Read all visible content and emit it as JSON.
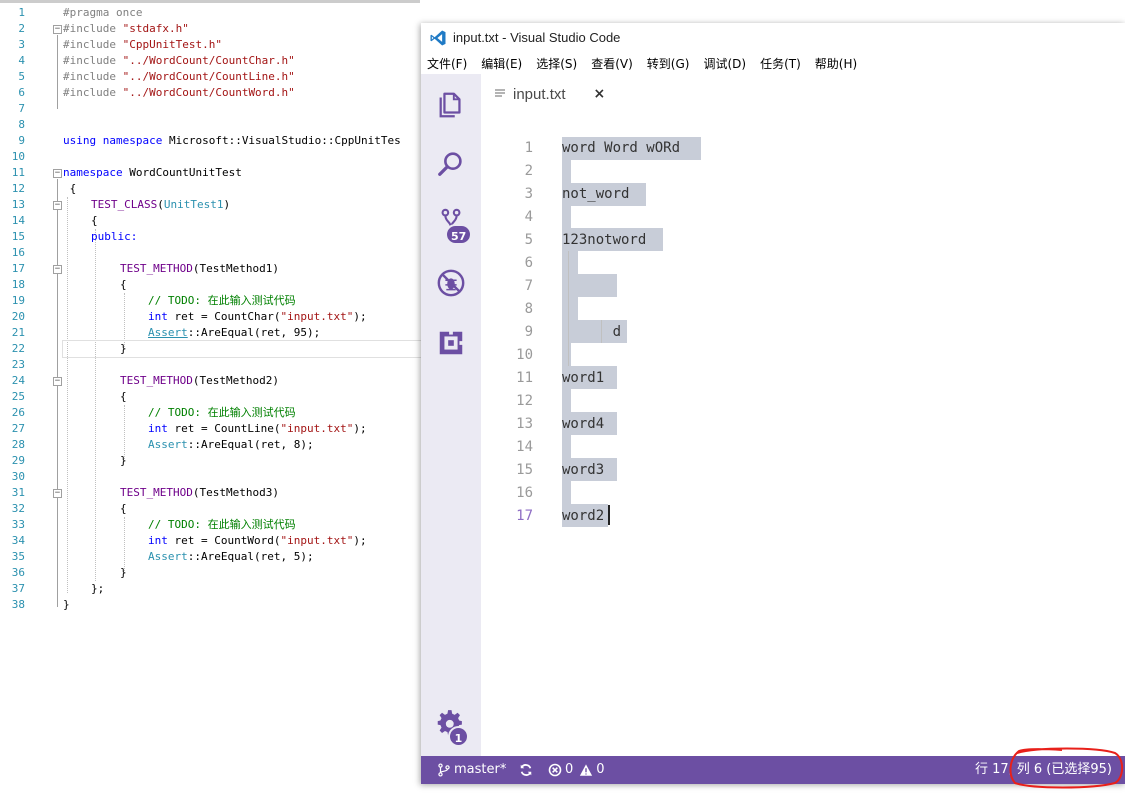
{
  "vs_editor": {
    "line_numbers": [
      "1",
      "2",
      "3",
      "4",
      "5",
      "6",
      "7",
      "8",
      "9",
      "10",
      "11",
      "12",
      "13",
      "14",
      "15",
      "16",
      "17",
      "18",
      "19",
      "20",
      "21",
      "22",
      "23",
      "24",
      "25",
      "26",
      "27",
      "28",
      "29",
      "30",
      "31",
      "32",
      "33",
      "34",
      "35",
      "36",
      "37",
      "38"
    ],
    "code": {
      "l1": "#pragma once",
      "l2a": "#include ",
      "l2b": "\"stdafx.h\"",
      "l3a": "#include ",
      "l3b": "\"CppUnitTest.h\"",
      "l4a": "#include ",
      "l4b": "\"../WordCount/CountChar.h\"",
      "l5a": "#include ",
      "l5b": "\"../WordCount/CountLine.h\"",
      "l6a": "#include ",
      "l6b": "\"../WordCount/CountWord.h\"",
      "l9a": "using namespace",
      "l9b": " Microsoft::VisualStudio::CppUnitTes",
      "l11a": "namespace",
      "l11b": " WordCountUnitTest",
      "l12": " {",
      "l13a": "TEST_CLASS",
      "l13b": "(",
      "l13c": "UnitTest1",
      "l13d": ")",
      "l14": "{",
      "l15": "public:",
      "l17a": "TEST_METHOD",
      "l17b": "(TestMethod1)",
      "l18": "{",
      "l19": "// TODO: 在此输入测试代码",
      "l20a": "int",
      "l20b": " ret = CountChar(",
      "l20c": "\"input.txt\"",
      "l20d": ");",
      "l21a": "Assert",
      "l21b": "::AreEqual(ret, 95);",
      "l22": "}",
      "l24a": "TEST_METHOD",
      "l24b": "(TestMethod2)",
      "l25": "{",
      "l26": "// TODO: 在此输入测试代码",
      "l27a": "int",
      "l27b": " ret = CountLine(",
      "l27c": "\"input.txt\"",
      "l27d": ");",
      "l28a": "Assert",
      "l28b": "::AreEqual(ret, 8);",
      "l29": "}",
      "l31a": "TEST_METHOD",
      "l31b": "(TestMethod3)",
      "l32": "{",
      "l33": "// TODO: 在此输入测试代码",
      "l34a": "int",
      "l34b": " ret = CountWord(",
      "l34c": "\"input.txt\"",
      "l34d": ");",
      "l35a": "Assert",
      "l35b": "::AreEqual(ret, 5);",
      "l36": "}",
      "l37": "};",
      "l38": "}"
    },
    "fold_symbol": "−"
  },
  "vscode": {
    "title": "input.txt - Visual Studio Code",
    "menu": [
      "文件(F)",
      "编辑(E)",
      "选择(S)",
      "查看(V)",
      "转到(G)",
      "调试(D)",
      "任务(T)",
      "帮助(H)"
    ],
    "activity": {
      "explorer_icon": "files-icon",
      "search_icon": "search-icon",
      "scm_icon": "source-control-icon",
      "scm_badge": "57",
      "debug_icon": "debug-icon",
      "extensions_icon": "extensions-icon",
      "settings_icon": "gear-icon",
      "settings_badge": "1"
    },
    "tab": {
      "label": "input.txt",
      "close": "×"
    },
    "lines": [
      {
        "n": "1",
        "text": "word Word wORd"
      },
      {
        "n": "2",
        "text": ""
      },
      {
        "n": "3",
        "text": "not_word"
      },
      {
        "n": "4",
        "text": ""
      },
      {
        "n": "5",
        "text": "123notword"
      },
      {
        "n": "6",
        "text": ""
      },
      {
        "n": "7",
        "text": ""
      },
      {
        "n": "8",
        "text": ""
      },
      {
        "n": "9",
        "text": "      d"
      },
      {
        "n": "10",
        "text": ""
      },
      {
        "n": "11",
        "text": "word1"
      },
      {
        "n": "12",
        "text": ""
      },
      {
        "n": "13",
        "text": "word4"
      },
      {
        "n": "14",
        "text": ""
      },
      {
        "n": "15",
        "text": "word3"
      },
      {
        "n": "16",
        "text": ""
      },
      {
        "n": "17",
        "text": "word2"
      }
    ],
    "active_line": "17",
    "status": {
      "branch": "master*",
      "errors": "0",
      "warnings": "0",
      "row_label": "行 17,",
      "col_label": "列 6 (已选择95)"
    },
    "colors": {
      "accent": "#6c4fa3",
      "activity_bg": "#ebeaf3",
      "selection": "#c8cdd8",
      "annotation": "#e8201a"
    }
  }
}
